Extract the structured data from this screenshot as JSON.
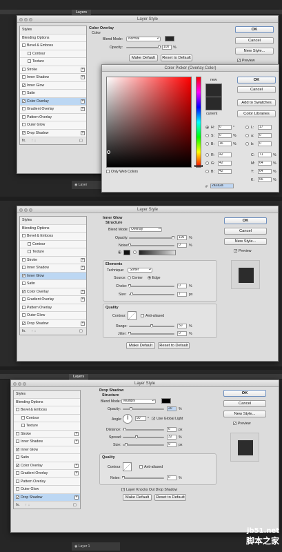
{
  "panel": {
    "strip_label": "Layers",
    "layer_label_2": "Layer",
    "layer_label_3": "Layer 1"
  },
  "style_list": {
    "items": [
      {
        "label": "Styles",
        "checkbox": false
      },
      {
        "label": "Blending Options",
        "checkbox": false
      },
      {
        "label": "Bevel & Emboss",
        "checkbox": true
      },
      {
        "label": "Contour",
        "checkbox": true,
        "indent": true
      },
      {
        "label": "Texture",
        "checkbox": true,
        "indent": true
      },
      {
        "label": "Stroke",
        "checkbox": true,
        "plus": true
      },
      {
        "label": "Inner Shadow",
        "checkbox": true,
        "plus": true
      },
      {
        "label": "Inner Glow",
        "checkbox": true
      },
      {
        "label": "Satin",
        "checkbox": true
      },
      {
        "label": "Color Overlay",
        "checkbox": true,
        "plus": true
      },
      {
        "label": "Gradient Overlay",
        "checkbox": true,
        "plus": true
      },
      {
        "label": "Pattern Overlay",
        "checkbox": true
      },
      {
        "label": "Outer Glow",
        "checkbox": true
      },
      {
        "label": "Drop Shadow",
        "checkbox": true,
        "plus": true
      }
    ],
    "footer_fx": "fx.",
    "footer_arrows": "↑ ↓",
    "footer_trash": "Ὕ1"
  },
  "dialogs": [
    {
      "title": "Layer Style",
      "checked": [
        "Inner Glow",
        "Color Overlay",
        "Drop Shadow"
      ],
      "selected": "Color Overlay",
      "section_title": "Color Overlay",
      "section_sub": "Color",
      "blend_label": "Blend Mode:",
      "blend_value": "Normal",
      "opacity_label": "Opacity:",
      "opacity_value": "100",
      "opacity_unit": "%",
      "make_default": "Make Default",
      "reset_default": "Reset to Default"
    },
    {
      "title": "Layer Style",
      "checked": [
        "Inner Glow",
        "Color Overlay",
        "Drop Shadow"
      ],
      "selected": "Inner Glow",
      "section_title": "Inner Glow",
      "section_sub": "Structure",
      "blend_label": "Blend Mode:",
      "blend_value": "Overlay",
      "opacity_label": "Opacity:",
      "opacity_value": "100",
      "noise_label": "Noise:",
      "noise_value": "0",
      "unit": "%",
      "elements_title": "Elements",
      "technique_label": "Technique:",
      "technique_value": "Softer",
      "source_label": "Source:",
      "center_label": "Center",
      "edge_label": "Edge",
      "choke_label": "Choke:",
      "choke_value": "0",
      "size_label": "Size:",
      "size_value": "7",
      "px": "px",
      "quality_title": "Quality",
      "contour_label": "Contour:",
      "antialiased_label": "Anti-aliased",
      "range_label": "Range:",
      "range_value": "50",
      "jitter_label": "Jitter:",
      "jitter_value": "0",
      "make_default": "Make Default",
      "reset_default": "Reset to Default"
    },
    {
      "title": "Layer Style",
      "checked": [
        "Inner Glow",
        "Color Overlay",
        "Drop Shadow"
      ],
      "selected": "Drop Shadow",
      "section_title": "Drop Shadow",
      "section_sub": "Structure",
      "blend_label": "Blend Mode:",
      "blend_value": "Multiply",
      "opacity_label": "Opacity:",
      "opacity_value": "20",
      "unit": "%",
      "angle_label": "Angle:",
      "angle_value": "90",
      "degree": "°",
      "global_light_label": "Use Global Light",
      "distance_label": "Distance:",
      "distance_value": "6",
      "spread_label": "Spread:",
      "spread_value": "32",
      "size_label": "Size:",
      "size_value": "9",
      "px": "px",
      "quality_title": "Quality",
      "contour_label": "Contour:",
      "antialiased_label": "Anti-aliased",
      "noise_label": "Noise:",
      "noise_value": "0",
      "knockout_label": "Layer Knocks Out Drop Shadow",
      "make_default": "Make Default",
      "reset_default": "Reset to Default"
    }
  ],
  "side_buttons": {
    "ok": "OK",
    "cancel": "Cancel",
    "new_style": "New Style...",
    "preview": "Preview"
  },
  "color_picker": {
    "title": "Color Picker (Overlay Color)",
    "ok": "OK",
    "cancel": "Cancel",
    "add_swatches": "Add to Swatches",
    "libraries": "Color Libraries",
    "new_label": "new",
    "current_label": "current",
    "only_web": "Only Web Colors",
    "fields": [
      {
        "label": "H:",
        "value": "0",
        "unit": "°",
        "radio": true,
        "on": true
      },
      {
        "label": "S:",
        "value": "0",
        "unit": "%",
        "radio": true
      },
      {
        "label": "B:",
        "value": "16",
        "unit": "%",
        "radio": true
      },
      {
        "label": "R:",
        "value": "42",
        "radio": true
      },
      {
        "label": "G:",
        "value": "42",
        "radio": true
      },
      {
        "label": "B:",
        "value": "42",
        "radio": true
      }
    ],
    "lab_fields": [
      {
        "label": "L:",
        "value": "17"
      },
      {
        "label": "a:",
        "value": "0"
      },
      {
        "label": "b:",
        "value": "0"
      }
    ],
    "cmyk_fields": [
      {
        "label": "C:",
        "value": "71",
        "unit": "%"
      },
      {
        "label": "M:",
        "value": "64",
        "unit": "%"
      },
      {
        "label": "Y:",
        "value": "64",
        "unit": "%"
      },
      {
        "label": "K:",
        "value": "66",
        "unit": "%"
      }
    ],
    "hex_label": "#",
    "hex_value": "2a2a2a",
    "new_color": "#2a2a2a",
    "current_color": "#2a2a2a"
  },
  "watermark": {
    "line1": "jb51.net",
    "line2": "脚本之家"
  },
  "colors": {
    "accent": "#6e8fbd",
    "selected_row": "#bcd7f3",
    "overlay_color": "#262626"
  }
}
